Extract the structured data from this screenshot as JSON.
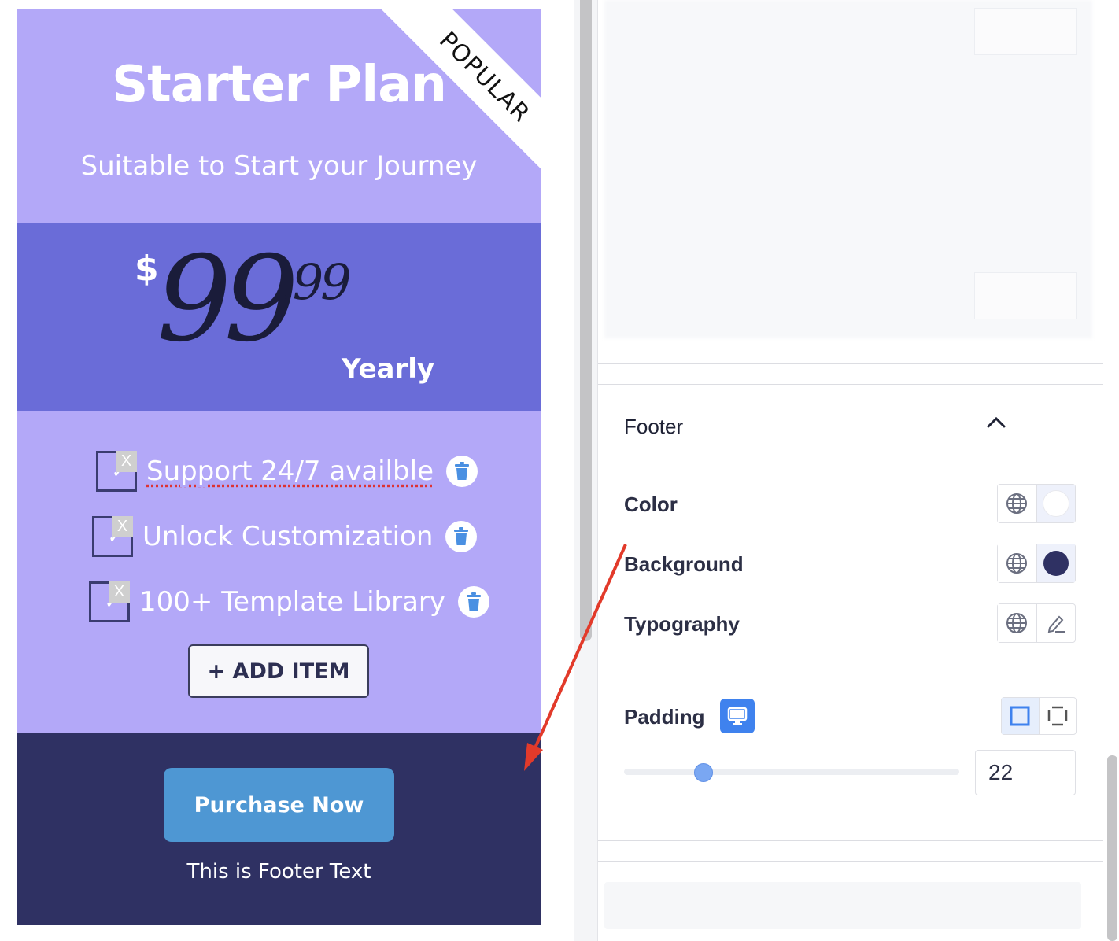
{
  "card": {
    "title": "Starter Plan",
    "subtitle": "Suitable to Start your Journey",
    "badge": "POPULAR",
    "currency": "$",
    "price_integer": "99",
    "price_decimal": ".99",
    "period": "Yearly",
    "features": [
      {
        "label": "Support 24/7 availble",
        "check_glyph": "✓",
        "remove_glyph": "X"
      },
      {
        "label": "Unlock Customization",
        "check_glyph": "✓",
        "remove_glyph": "X"
      },
      {
        "label": "100+ Template Library",
        "check_glyph": "✓",
        "remove_glyph": "X"
      }
    ],
    "add_item_label": "+ ADD ITEM",
    "cta_label": "Purchase Now",
    "footer_text": "This is Footer Text",
    "colors": {
      "header_bg": "#b3a8f8",
      "price_bg": "#6a6cd8",
      "footer_bg": "#2f3163",
      "cta_bg": "#4e97d3"
    }
  },
  "panel": {
    "section_title": "Footer",
    "rows": {
      "color_label": "Color",
      "background_label": "Background",
      "typography_label": "Typography",
      "padding_label": "Padding"
    },
    "color_swatch": "#ffffff",
    "background_swatch": "#2f3163",
    "padding_value": "22",
    "padding_slider_fraction": 0.22,
    "icons": [
      "globe-icon",
      "edit-pencil-icon",
      "desktop-icon",
      "chevron-up-icon",
      "trash-icon"
    ]
  }
}
